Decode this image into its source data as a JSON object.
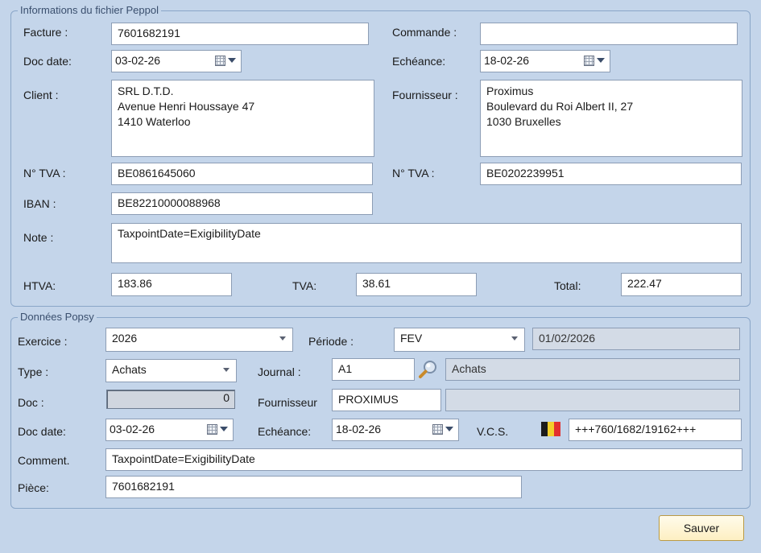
{
  "peppol": {
    "legend": "Informations du fichier Peppol",
    "facture_label": "Facture :",
    "facture": "7601682191",
    "commande_label": "Commande :",
    "commande": "",
    "doc_date_label": "Doc date:",
    "doc_date": "03-02-26",
    "echeance_label": "Echéance:",
    "echeance": "18-02-26",
    "client_label": "Client :",
    "client": "SRL D.T.D.\nAvenue Henri Houssaye 47\n1410 Waterloo",
    "fournisseur_label": "Fournisseur :",
    "fournisseur": "Proximus\nBoulevard du Roi Albert II, 27\n1030 Bruxelles",
    "tva_label": "N° TVA :",
    "client_tva": "BE0861645060",
    "fournisseur_tva": "BE0202239951",
    "iban_label": "IBAN :",
    "iban": "BE82210000088968",
    "note_label": "Note :",
    "note": "TaxpointDate=ExigibilityDate",
    "htva_label": "HTVA:",
    "htva": "183.86",
    "tvaamt_label": "TVA:",
    "tvaamt": "38.61",
    "total_label": "Total:",
    "total": "222.47"
  },
  "popsy": {
    "legend": "Données Popsy",
    "exercice_label": "Exercice :",
    "exercice": "2026",
    "periode_label": "Période :",
    "periode": "FEV",
    "periode_date": "01/02/2026",
    "type_label": "Type :",
    "type": "Achats",
    "journal_label": "Journal :",
    "journal": "A1",
    "journal_name": "Achats",
    "doc_label": "Doc :",
    "doc": "0",
    "fournisseur_label": "Fournisseur",
    "fournisseur": "PROXIMUS",
    "fournisseur_name": "",
    "doc_date_label": "Doc date:",
    "doc_date": "03-02-26",
    "echeance_label": "Echéance:",
    "echeance": "18-02-26",
    "vcs_label": "V.C.S.",
    "vcs": "+++760/1682/19162+++",
    "comment_label": "Comment.",
    "comment": "TaxpointDate=ExigibilityDate",
    "piece_label": "Pièce:",
    "piece": "7601682191"
  },
  "actions": {
    "save_label": "Sauver"
  },
  "colors": {
    "background": "#c4d5ea",
    "flag_black": "#1c1c1c",
    "flag_yellow": "#f3cf2c",
    "flag_red": "#e2302f"
  }
}
